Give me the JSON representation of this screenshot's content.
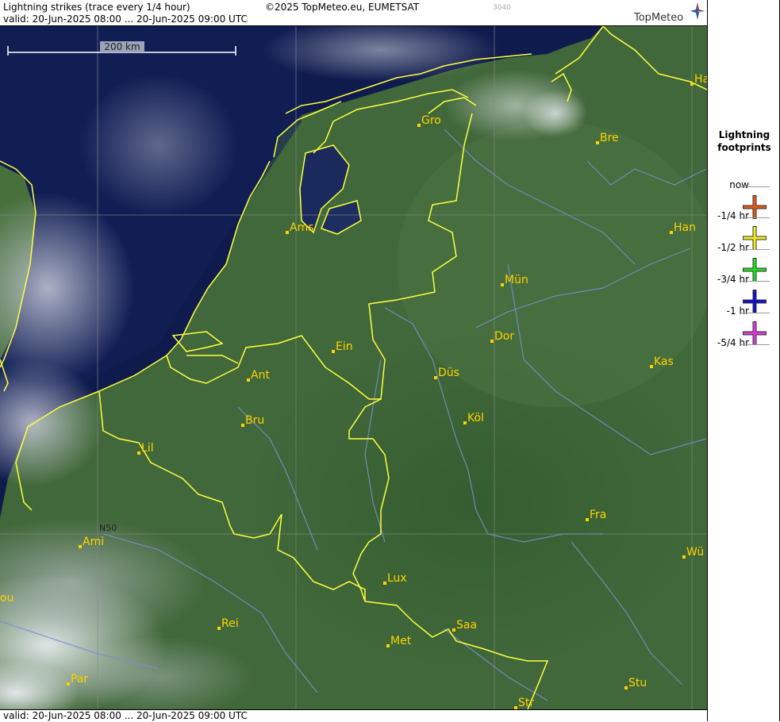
{
  "header": {
    "title": "Lightning strikes (trace every 1/4 hour)",
    "valid": "valid:  20-Jun-2025 08:00 ... 20-Jun-2025 09:00 UTC",
    "copyright": "©2025 TopMeteo.eu, EUMETSAT",
    "code": "3040",
    "logo_text": "TopMeteo"
  },
  "footer": {
    "valid": "valid:  20-Jun-2025 08:00 ... 20-Jun-2025 09:00 UTC"
  },
  "map": {
    "scale_label": "200 km",
    "lat_label": "N50",
    "cities": [
      "Gro",
      "Bre",
      "Ha",
      "Ams",
      "Han",
      "Mün",
      "Dor",
      "Ein",
      "Ant",
      "Düs",
      "Kas",
      "Bru",
      "Köl",
      "Lil",
      "Fra",
      "Ami",
      "Wü",
      "Lux",
      "Saa",
      "Rei",
      "Met",
      "Par",
      "Stu",
      "Str",
      "ou"
    ]
  },
  "legend": {
    "title_line1": "Lightning",
    "title_line2": "footprints",
    "items": [
      {
        "label": "now",
        "color": "#e05a1a"
      },
      {
        "label": "-1/4 hr",
        "color": "#f2ef1e"
      },
      {
        "label": "-1/2 hr",
        "color": "#22dd22"
      },
      {
        "label": "-3/4 hr",
        "color": "#1010cc"
      },
      {
        "label": "-1 hr",
        "color": "#d83bd8"
      },
      {
        "label": "-5/4 hr",
        "color": ""
      }
    ]
  },
  "colors": {
    "border": "#ffff40",
    "land": "#41683a",
    "sea": "#0e1a4a",
    "city": "#ffd200"
  }
}
